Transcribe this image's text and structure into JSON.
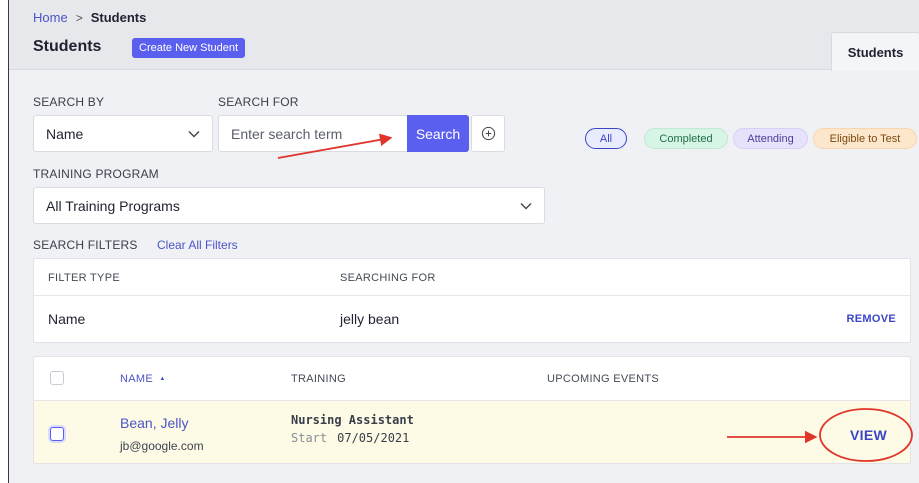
{
  "breadcrumb": {
    "home": "Home",
    "separator": ">",
    "current": "Students"
  },
  "header": {
    "title": "Students",
    "create_button": "Create New Student",
    "tab": "Students"
  },
  "search": {
    "search_by_label": "SEARCH BY",
    "search_by_value": "Name",
    "search_for_label": "SEARCH FOR",
    "placeholder": "Enter search term",
    "button": "Search"
  },
  "status_filters": [
    "All",
    "Completed",
    "Attending",
    "Eligible to Test"
  ],
  "training_program": {
    "label": "TRAINING PROGRAM",
    "value": "All Training Programs"
  },
  "filters": {
    "label": "SEARCH FILTERS",
    "clear_all": "Clear All Filters",
    "columns": [
      "FILTER TYPE",
      "SEARCHING FOR"
    ],
    "rows": [
      {
        "type": "Name",
        "value": "jelly bean",
        "action": "REMOVE"
      }
    ]
  },
  "students_table": {
    "columns": [
      "NAME",
      "TRAINING",
      "UPCOMING EVENTS"
    ],
    "sort_indicator": "▲",
    "rows": [
      {
        "name": "Bean, Jelly",
        "email": "jb@google.com",
        "training": "Nursing Assistant",
        "start_label": "Start",
        "start_date": "07/05/2021",
        "action": "VIEW"
      }
    ]
  },
  "colors": {
    "accent": "#5a5ff0",
    "link": "#4b55c8",
    "annotation": "#e0352b",
    "row_highlight": "#fdfbe6"
  }
}
